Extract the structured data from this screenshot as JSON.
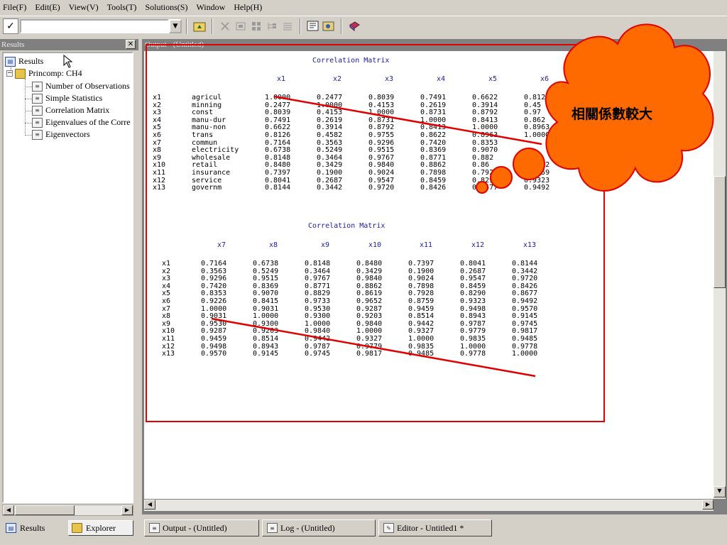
{
  "menubar": {
    "items": [
      "File(F)",
      "Edit(E)",
      "View(V)",
      "Tools(T)",
      "Solutions(S)",
      "Window",
      "Help(H)"
    ]
  },
  "toolbar": {
    "command_value": "",
    "check_glyph": "✓",
    "dropdown_glyph": "▼"
  },
  "results_panel": {
    "title": "Results",
    "close_glyph": "✕",
    "tree": {
      "root": "Results",
      "folder": "Princomp:  CH4",
      "items": [
        "Number of Observations",
        "Simple Statistics",
        "Correlation Matrix",
        "Eigenvalues of the Corre",
        "Eigenvectors"
      ]
    },
    "tabs": [
      "Results",
      "Explorer"
    ]
  },
  "output_window": {
    "title": "Output - (Untitled)",
    "table1": {
      "title": "Correlation Matrix",
      "columns": [
        "x1",
        "x2",
        "x3",
        "x4",
        "x5",
        "x6"
      ],
      "rows": [
        {
          "id": "x1",
          "name": "agricul",
          "values": [
            "1.0000",
            "0.2477",
            "0.8039",
            "0.7491",
            "0.6622",
            "0.812"
          ]
        },
        {
          "id": "x2",
          "name": "minning",
          "values": [
            "0.2477",
            "1.0000",
            "0.4153",
            "0.2619",
            "0.3914",
            "0.45"
          ]
        },
        {
          "id": "x3",
          "name": "const",
          "values": [
            "0.8039",
            "0.4153",
            "1.0000",
            "0.8731",
            "0.8792",
            "0.97"
          ]
        },
        {
          "id": "x4",
          "name": "manu-dur",
          "values": [
            "0.7491",
            "0.2619",
            "0.8731",
            "1.0000",
            "0.8413",
            "0.862"
          ]
        },
        {
          "id": "x5",
          "name": "manu-non",
          "values": [
            "0.6622",
            "0.3914",
            "0.8792",
            "0.8413",
            "1.0000",
            "0.8963"
          ]
        },
        {
          "id": "x6",
          "name": "trans",
          "values": [
            "0.8126",
            "0.4582",
            "0.9755",
            "0.8622",
            "0.8963",
            "1.0000"
          ]
        },
        {
          "id": "x7",
          "name": "commun",
          "values": [
            "0.7164",
            "0.3563",
            "0.9296",
            "0.7420",
            "0.8353",
            ""
          ]
        },
        {
          "id": "x8",
          "name": "electricity",
          "values": [
            "0.6738",
            "0.5249",
            "0.9515",
            "0.8369",
            "0.9070",
            ""
          ]
        },
        {
          "id": "x9",
          "name": "wholesale",
          "values": [
            "0.8148",
            "0.3464",
            "0.9767",
            "0.8771",
            "0.882",
            ""
          ]
        },
        {
          "id": "x10",
          "name": "retail",
          "values": [
            "0.8480",
            "0.3429",
            "0.9840",
            "0.8862",
            "0.86",
            "0.9652"
          ]
        },
        {
          "id": "x11",
          "name": "insurance",
          "values": [
            "0.7397",
            "0.1900",
            "0.9024",
            "0.7898",
            "0.7928",
            "0.8759"
          ]
        },
        {
          "id": "x12",
          "name": "service",
          "values": [
            "0.8041",
            "0.2687",
            "0.9547",
            "0.8459",
            "0.8290",
            "0.9323"
          ]
        },
        {
          "id": "x13",
          "name": "governm",
          "values": [
            "0.8144",
            "0.3442",
            "0.9720",
            "0.8426",
            "0.8677",
            "0.9492"
          ]
        }
      ]
    },
    "table2": {
      "title": "Correlation Matrix",
      "columns": [
        "x7",
        "x8",
        "x9",
        "x10",
        "x11",
        "x12",
        "x13"
      ],
      "rows": [
        {
          "id": "x1",
          "values": [
            "0.7164",
            "0.6738",
            "0.8148",
            "0.8480",
            "0.7397",
            "0.8041",
            "0.8144"
          ]
        },
        {
          "id": "x2",
          "values": [
            "0.3563",
            "0.5249",
            "0.3464",
            "0.3429",
            "0.1900",
            "0.2687",
            "0.3442"
          ]
        },
        {
          "id": "x3",
          "values": [
            "0.9296",
            "0.9515",
            "0.9767",
            "0.9840",
            "0.9024",
            "0.9547",
            "0.9720"
          ]
        },
        {
          "id": "x4",
          "values": [
            "0.7420",
            "0.8369",
            "0.8771",
            "0.8862",
            "0.7898",
            "0.8459",
            "0.8426"
          ]
        },
        {
          "id": "x5",
          "values": [
            "0.8353",
            "0.9070",
            "0.8829",
            "0.8619",
            "0.7928",
            "0.8290",
            "0.8677"
          ]
        },
        {
          "id": "x6",
          "values": [
            "0.9226",
            "0.8415",
            "0.9733",
            "0.9652",
            "0.8759",
            "0.9323",
            "0.9492"
          ]
        },
        {
          "id": "x7",
          "values": [
            "1.0000",
            "0.9031",
            "0.9530",
            "0.9287",
            "0.9459",
            "0.9498",
            "0.9570"
          ]
        },
        {
          "id": "x8",
          "values": [
            "0.9031",
            "1.0000",
            "0.9300",
            "0.9203",
            "0.8514",
            "0.8943",
            "0.9145"
          ]
        },
        {
          "id": "x9",
          "values": [
            "0.9530",
            "0.9300",
            "1.0000",
            "0.9840",
            "0.9442",
            "0.9787",
            "0.9745"
          ]
        },
        {
          "id": "x10",
          "values": [
            "0.9287",
            "0.9203",
            "0.9840",
            "1.0000",
            "0.9327",
            "0.9779",
            "0.9817"
          ]
        },
        {
          "id": "x11",
          "values": [
            "0.9459",
            "0.8514",
            "0.9442",
            "0.9327",
            "1.0000",
            "0.9835",
            "0.9485"
          ]
        },
        {
          "id": "x12",
          "values": [
            "0.9498",
            "0.8943",
            "0.9787",
            "0.9779",
            "0.9835",
            "1.0000",
            "0.9778"
          ]
        },
        {
          "id": "x13",
          "values": [
            "0.9570",
            "0.9145",
            "0.9745",
            "0.9817",
            "0.9485",
            "0.9778",
            "1.0000"
          ]
        }
      ]
    }
  },
  "callout": {
    "text": "相關係數較大",
    "fill_color": "#ff6a00",
    "outline_color": "#e00000"
  },
  "annotation_color": "#e00000",
  "window_tabs": [
    "Output - (Untitled)",
    "Log - (Untitled)",
    "Editor - Untitled1 *"
  ]
}
